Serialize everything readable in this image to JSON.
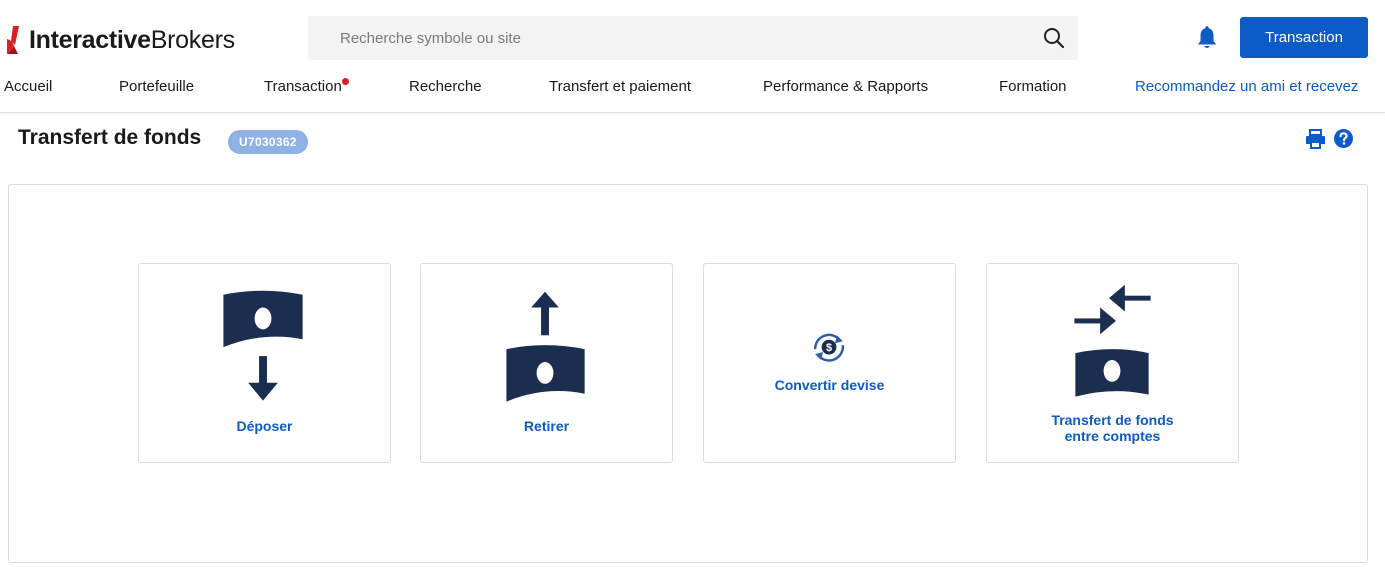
{
  "header": {
    "logo": {
      "bold": "Interactive",
      "regular": "Brokers"
    },
    "search": {
      "placeholder": "Recherche symbole ou site",
      "icon": "search-icon"
    },
    "notifications_icon": "bell-icon",
    "trade_button_label": "Transaction",
    "accent_color": "#0c5bc7"
  },
  "nav": {
    "items": [
      {
        "label": "Accueil"
      },
      {
        "label": "Portefeuille"
      },
      {
        "label": "Transaction",
        "has_dot": true
      },
      {
        "label": "Recherche"
      },
      {
        "label": "Transfert et paiement"
      },
      {
        "label": "Performance & Rapports"
      },
      {
        "label": "Formation"
      },
      {
        "label": "Recommandez un ami et recevez"
      }
    ]
  },
  "page": {
    "title": "Transfert de fonds",
    "account_id": "U7030362",
    "print_icon": "print-icon",
    "help_icon": "help-icon"
  },
  "cards": [
    {
      "label": "Déposer",
      "icon": "deposit-icon"
    },
    {
      "label": "Retirer",
      "icon": "withdraw-icon"
    },
    {
      "label": "Convertir devise",
      "icon": "currency-convert-icon"
    },
    {
      "label": "Transfert de fonds entre comptes",
      "line1": "Transfert de fonds",
      "line2": "entre comptes",
      "icon": "transfer-between-accounts-icon"
    }
  ],
  "colors": {
    "icon_navy": "#1c2e4f",
    "badge": "#8fb1e6",
    "notification_dot": "#d91e2a"
  }
}
